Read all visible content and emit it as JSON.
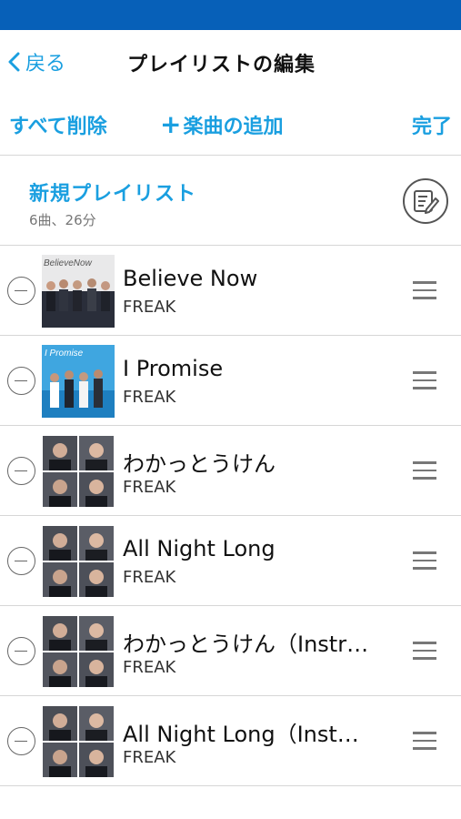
{
  "nav": {
    "back_label": "戻る",
    "title": "プレイリストの編集"
  },
  "toolbar": {
    "delete_all_label": "すべて削除",
    "add_song_label": "楽曲の追加",
    "done_label": "完了"
  },
  "playlist": {
    "name": "新規プレイリスト",
    "meta": "6曲、26分"
  },
  "songs": [
    {
      "title": "Believe Now",
      "artist": "FREAK",
      "art_text": "BelieveNow"
    },
    {
      "title": "I Promise",
      "artist": "FREAK",
      "art_text": "I Promise"
    },
    {
      "title": "わかっとうけん",
      "artist": "FREAK"
    },
    {
      "title": "All Night Long",
      "artist": "FREAK"
    },
    {
      "title": "わかっとうけん（Instr…",
      "artist": "FREAK"
    },
    {
      "title": "All Night Long（Inst…",
      "artist": "FREAK"
    }
  ],
  "colors": {
    "accent": "#1a9fe0",
    "status_bar": "#0760b8",
    "divider": "#d6d6d6"
  }
}
